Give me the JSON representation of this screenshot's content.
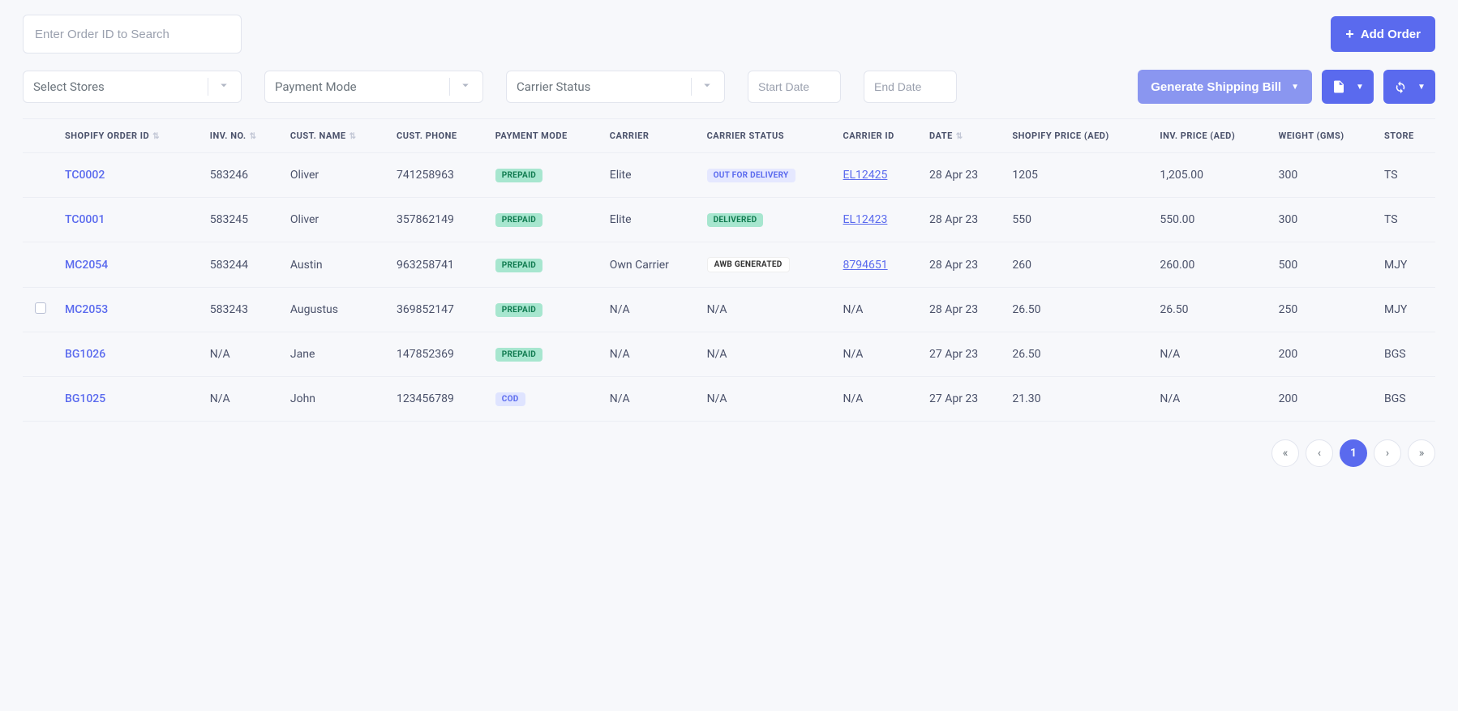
{
  "search": {
    "placeholder": "Enter Order ID to Search"
  },
  "addOrder": "Add Order",
  "selects": {
    "stores": "Select Stores",
    "payment": "Payment Mode",
    "carrier": "Carrier Status"
  },
  "dates": {
    "startPlaceholder": "Start Date",
    "endPlaceholder": "End Date"
  },
  "actions": {
    "generateShipping": "Generate Shipping Bill"
  },
  "columns": {
    "orderId": "SHOPIFY ORDER ID",
    "invNo": "INV. NO.",
    "custName": "CUST. NAME",
    "custPhone": "CUST. PHONE",
    "paymentMode": "PAYMENT MODE",
    "carrier": "CARRIER",
    "carrierStatus": "CARRIER STATUS",
    "carrierId": "CARRIER ID",
    "date": "DATE",
    "shopifyPrice": "SHOPIFY PRICE (AED)",
    "invPrice": "INV. PRICE (AED)",
    "weight": "WEIGHT (GMS)",
    "store": "STORE"
  },
  "badges": {
    "prepaid": "PREPAID",
    "cod": "COD",
    "outForDelivery": "OUT FOR DELIVERY",
    "delivered": "DELIVERED",
    "awbGenerated": "AWB GENERATED"
  },
  "rows": [
    {
      "orderId": "TC0002",
      "invNo": "583246",
      "custName": "Oliver",
      "custPhone": "741258963",
      "payment": "prepaid",
      "carrier": "Elite",
      "status": "outForDelivery",
      "carrierId": "EL12425",
      "date": "28 Apr 23",
      "shopifyPrice": "1205",
      "invPrice": "1,205.00",
      "weight": "300",
      "store": "TS",
      "showCheck": false
    },
    {
      "orderId": "TC0001",
      "invNo": "583245",
      "custName": "Oliver",
      "custPhone": "357862149",
      "payment": "prepaid",
      "carrier": "Elite",
      "status": "delivered",
      "carrierId": "EL12423",
      "date": "28 Apr 23",
      "shopifyPrice": "550",
      "invPrice": "550.00",
      "weight": "300",
      "store": "TS",
      "showCheck": false
    },
    {
      "orderId": "MC2054",
      "invNo": "583244",
      "custName": "Austin",
      "custPhone": "963258741",
      "payment": "prepaid",
      "carrier": "Own Carrier",
      "status": "awbGenerated",
      "carrierId": "8794651",
      "date": "28 Apr 23",
      "shopifyPrice": "260",
      "invPrice": "260.00",
      "weight": "500",
      "store": "MJY",
      "showCheck": false
    },
    {
      "orderId": "MC2053",
      "invNo": "583243",
      "custName": "Augustus",
      "custPhone": "369852147",
      "payment": "prepaid",
      "carrier": "N/A",
      "status": "na",
      "carrierId": "N/A",
      "date": "28 Apr 23",
      "shopifyPrice": "26.50",
      "invPrice": "26.50",
      "weight": "250",
      "store": "MJY",
      "showCheck": true
    },
    {
      "orderId": "BG1026",
      "invNo": "N/A",
      "custName": "Jane",
      "custPhone": "147852369",
      "payment": "prepaid",
      "carrier": "N/A",
      "status": "na",
      "carrierId": "N/A",
      "date": "27 Apr 23",
      "shopifyPrice": "26.50",
      "invPrice": "N/A",
      "weight": "200",
      "store": "BGS",
      "showCheck": false
    },
    {
      "orderId": "BG1025",
      "invNo": "N/A",
      "custName": "John",
      "custPhone": "123456789",
      "payment": "cod",
      "carrier": "N/A",
      "status": "na",
      "carrierId": "N/A",
      "date": "27 Apr 23",
      "shopifyPrice": "21.30",
      "invPrice": "N/A",
      "weight": "200",
      "store": "BGS",
      "showCheck": false
    }
  ],
  "pagination": {
    "current": "1"
  }
}
